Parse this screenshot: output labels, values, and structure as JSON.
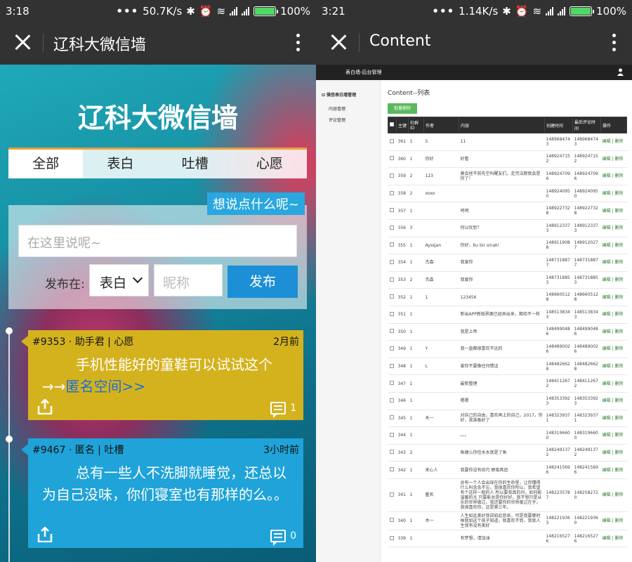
{
  "left": {
    "status": {
      "time": "3:18",
      "speed": "50.7K/s",
      "battery": "100%"
    },
    "titlebar": {
      "title": "辽科大微信墙"
    },
    "wall": {
      "title": "辽科大微信墙",
      "tabs": [
        "全部",
        "表白",
        "吐槽",
        "心愿"
      ],
      "say_badge": "想说点什么呢~",
      "textarea_placeholder": "在这里说呢~",
      "publish_to_label": "发布在:",
      "category_selected": "表白",
      "nickname_placeholder": "昵称",
      "publish_button": "发布"
    },
    "posts": [
      {
        "meta": "#9353 · 助手君 | 心愿",
        "time": "2月前",
        "text": "手机性能好的童鞋可以试试这个→→",
        "link": "匿名空间>>",
        "comments": "1"
      },
      {
        "meta": "#9467 · 匿名 | 吐槽",
        "time": "3小时前",
        "text": "总有一些人不洗脚就睡觉，还总以为自己没味，你们寝室也有那样的么。。",
        "comments": "0"
      }
    ],
    "colors": {
      "post1": "#d4b21e",
      "post2": "#1fa3d8",
      "tab_accent": "#e9a23b",
      "publish": "#1d8fd6"
    }
  },
  "right": {
    "status": {
      "time": "3:21",
      "speed": "1.14K/s",
      "battery": "100%"
    },
    "titlebar": {
      "title": "Content"
    },
    "admin": {
      "brand": "表白墙-后台管理",
      "sidebar": {
        "group": "微信表白墙管理",
        "items": [
          "内容管理",
          "评论管理"
        ]
      },
      "heading": "Content--列表",
      "batch_delete": "批量删除",
      "columns": [
        "主键",
        "社群ID",
        "作者",
        "内容",
        "创建时间",
        "最后评论时间",
        "操作"
      ],
      "rows": [
        [
          "361",
          "1",
          "5",
          "11",
          "1489684743",
          "1489684743",
          "编辑 | 删除"
        ],
        [
          "360",
          "1",
          "你好",
          "好看",
          "1489247152",
          "1489247152",
          "编辑 | 删除"
        ],
        [
          "359",
          "2",
          "123",
          "莫会挫不前先空叫醒友们，走完法颜就会是你了！",
          "1489247096",
          "1489247096",
          "编辑 | 删除"
        ],
        [
          "358",
          "2",
          "xoxo",
          "",
          "1489240950",
          "1489240950",
          "编辑 | 删除"
        ],
        [
          "357",
          "1",
          "",
          "呵呵",
          "1489227328",
          "1489227328",
          "编辑 | 删除"
        ],
        [
          "356",
          "3",
          "",
          "何以忧愁？",
          "1489123373",
          "1489123373",
          "编辑 | 删除"
        ],
        [
          "355",
          "1",
          "Ayssjan",
          "你好，bu bir sinak!",
          "1489119088",
          "1489120277",
          "编辑 | 删除"
        ],
        [
          "354",
          "1",
          "杰森",
          "我爱你",
          "1487318877",
          "1487318877",
          "编辑 | 删除"
        ],
        [
          "353",
          "2",
          "杰森",
          "我爱你",
          "1487318853",
          "1487318853",
          "编辑 | 删除"
        ],
        [
          "352",
          "1",
          "1",
          "123456",
          "1486605128",
          "1486605128",
          "编辑 | 删除"
        ],
        [
          "351",
          "1",
          "",
          "新出APP新版界面已经弄出来，期待不一样",
          "1485138343",
          "1485138343",
          "编辑 | 删除"
        ],
        [
          "350",
          "1",
          "",
          "我是上帝",
          "1484990486",
          "1484990486",
          "编辑 | 删除"
        ],
        [
          "349",
          "1",
          "Y",
          "我一直都很喜欢不远的",
          "1484890026",
          "1484890026",
          "编辑 | 删除"
        ],
        [
          "348",
          "1",
          "L",
          "爱你不要像任何情话",
          "1484826628",
          "1484826628",
          "编辑 | 删除"
        ],
        [
          "347",
          "1",
          "",
          "最新整理",
          "1484112672",
          "1484112672",
          "编辑 | 删除"
        ],
        [
          "346",
          "1",
          "",
          "嗯嗯",
          "1483533923",
          "1483533923",
          "编辑 | 删除"
        ],
        [
          "345",
          "1",
          "木一",
          "对自己的自由，喜欢再上的自己，2017，你好，我准备好了",
          "1483239371",
          "1483239371",
          "编辑 | 删除"
        ],
        [
          "344",
          "1",
          "",
          "。。。",
          "1483196600",
          "1483196600",
          "编辑 | 删除"
        ],
        [
          "343",
          "2",
          "",
          "鱼塘么你任水水就是了鱼",
          "1482491372",
          "1482491372",
          "编辑 | 删除"
        ],
        [
          "342",
          "1",
          "来心人",
          "我要你没有技巧 野蛮具追",
          "1482415696",
          "1482415696",
          "编辑 | 删除"
        ],
        [
          "341",
          "1",
          "匿名",
          "总有一个人会出现在你的生命里，让你懂得什么叫念念不忘，我很喜欢你所以，我希望有个这样一般的人 所以要我真的问，如何能温暖的光 只要能总是你好好，我不想只是从乐的世界做过，我还要你的世界度过在乎。我很喜欢你，这是第三年。",
          "1482235787",
          "1482582720",
          "编辑 | 删除"
        ],
        [
          "340",
          "1",
          "木一",
          "人生如此美好我却如此悲哀，可是我要哪时候就如这个孩子知道，就喜欢不到，我就人生我有没有美好",
          "1482219363",
          "1482219360",
          "编辑 | 删除"
        ],
        [
          "339",
          "1",
          "",
          "有梦想，请加油",
          "1482165276",
          "1482165276",
          "编辑 | 删除"
        ]
      ]
    }
  }
}
